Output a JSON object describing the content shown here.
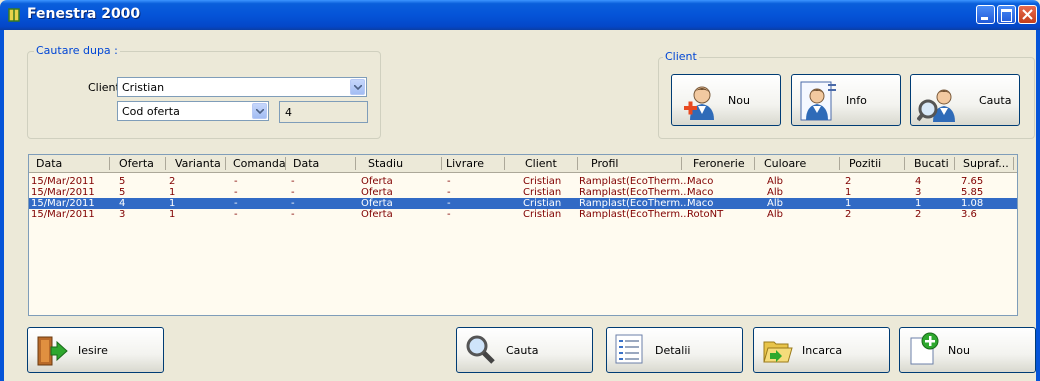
{
  "window": {
    "title": "Fenestra 2000"
  },
  "search_group": {
    "legend": "Cautare dupa :",
    "client_label": "Client",
    "client_value": "Cristian",
    "field_value": "Cod oferta",
    "search_value": "4"
  },
  "client_group": {
    "legend": "Client",
    "buttons": {
      "nou": "Nou",
      "info": "Info",
      "cauta": "Cauta"
    }
  },
  "table": {
    "columns": [
      "Data",
      "Oferta",
      "Varianta",
      "Comanda",
      "Data",
      "Stadiu",
      "Livrare",
      "Client",
      "Profil",
      "Feronerie",
      "Culoare",
      "Pozitii",
      "Bucati",
      "Supraf..."
    ],
    "rows": [
      [
        "15/Mar/2011",
        "5",
        "2",
        "-",
        "-",
        "Oferta",
        "-",
        "Cristian",
        "Ramplast(EcoTherm...",
        "Maco",
        "Alb",
        "2",
        "4",
        "7.65"
      ],
      [
        "15/Mar/2011",
        "5",
        "1",
        "-",
        "-",
        "Oferta",
        "-",
        "Cristian",
        "Ramplast(EcoTherm...",
        "Maco",
        "Alb",
        "1",
        "3",
        "5.85"
      ],
      [
        "15/Mar/2011",
        "4",
        "1",
        "-",
        "-",
        "Oferta",
        "-",
        "Cristian",
        "Ramplast(EcoTherm...",
        "Maco",
        "Alb",
        "1",
        "1",
        "1.08"
      ],
      [
        "15/Mar/2011",
        "3",
        "1",
        "-",
        "-",
        "Oferta",
        "-",
        "Cristian",
        "Ramplast(EcoTherm...",
        "RotoNT",
        "Alb",
        "2",
        "2",
        "3.6"
      ]
    ],
    "selected_row": 2
  },
  "bottom": {
    "iesire": "Iesire",
    "cauta": "Cauta",
    "detalii": "Detalii",
    "incarca": "Incarca",
    "nou": "Nou"
  }
}
